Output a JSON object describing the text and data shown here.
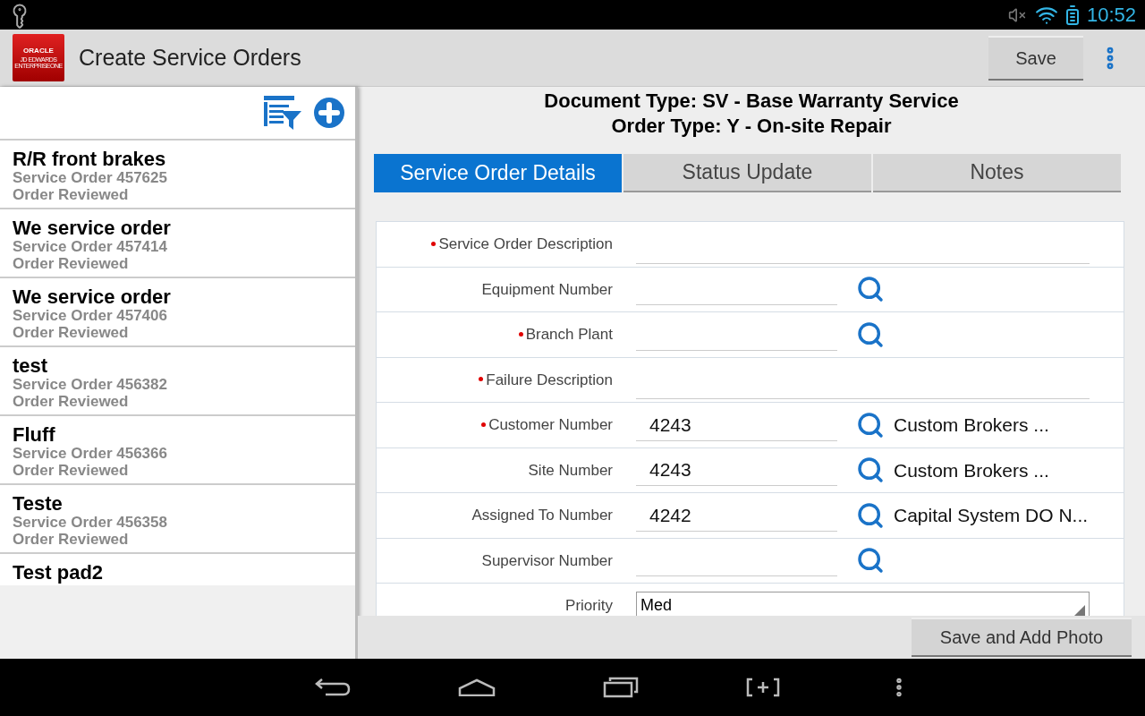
{
  "status_bar": {
    "time": "10:52"
  },
  "app_bar": {
    "logo": {
      "brand": "ORACLE",
      "line_1": "JD EDWARDS",
      "line_2": "ENTERPRISEONE"
    },
    "title": "Create Service Orders",
    "save": "Save"
  },
  "orders": [
    {
      "title": "R/R front brakes",
      "number": "Service Order 457625",
      "status": "Order Reviewed"
    },
    {
      "title": "We service order",
      "number": "Service Order 457414",
      "status": "Order Reviewed"
    },
    {
      "title": "We service order",
      "number": "Service Order 457406",
      "status": "Order Reviewed"
    },
    {
      "title": "test",
      "number": "Service Order 456382",
      "status": "Order Reviewed"
    },
    {
      "title": "Fluff",
      "number": "Service Order 456366",
      "status": "Order Reviewed"
    },
    {
      "title": "Teste",
      "number": "Service Order 456358",
      "status": "Order Reviewed"
    },
    {
      "title": "Test pad2"
    }
  ],
  "header": {
    "document_type": "Document Type: SV - Base Warranty Service",
    "order_type": "Order Type: Y - On-site Repair"
  },
  "tabs": [
    {
      "label": "Service Order Details",
      "selected": true
    },
    {
      "label": "Status Update",
      "selected": false
    },
    {
      "label": "Notes",
      "selected": false
    }
  ],
  "fields": [
    {
      "kind": "text",
      "label": "Service Order Description",
      "required": true
    },
    {
      "kind": "lookup",
      "label": "Equipment Number",
      "required": false
    },
    {
      "kind": "lookup",
      "label": "Branch Plant",
      "required": true
    },
    {
      "kind": "text",
      "label": "Failure Description",
      "required": true
    },
    {
      "kind": "lookup",
      "label": "Customer Number",
      "required": true,
      "value": "4243",
      "name": "Custom Brokers ..."
    },
    {
      "kind": "lookup",
      "label": "Site Number",
      "required": false,
      "value": "4243",
      "name": "Custom Brokers ..."
    },
    {
      "kind": "lookup",
      "label": "Assigned To Number",
      "required": false,
      "value": "4242",
      "name": "Capital System DO N..."
    },
    {
      "kind": "lookup",
      "label": "Supervisor Number",
      "required": false
    },
    {
      "kind": "dropdown",
      "label": "Priority",
      "required": false,
      "value": "Med"
    }
  ],
  "footer": {
    "button": "Save and Add Photo"
  }
}
